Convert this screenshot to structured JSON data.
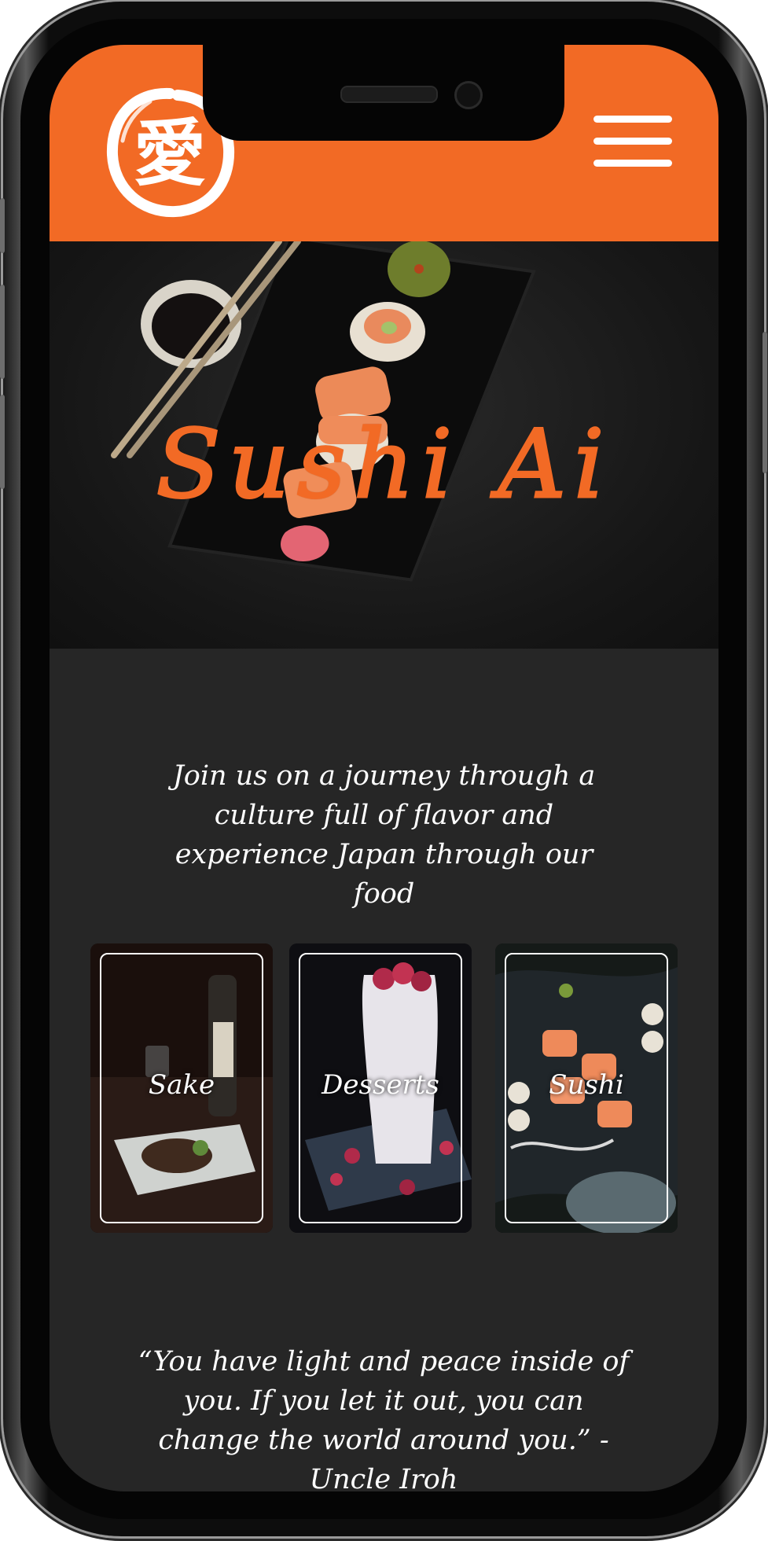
{
  "header": {
    "logo_alt": "Sushi Ai logo",
    "logo_glyph": "愛",
    "menu_icon": "hamburger-menu-icon"
  },
  "hero": {
    "title": "Sushi Ai"
  },
  "intro": {
    "tagline": "Join us on a journey through a culture full of flavor and experience Japan through our food"
  },
  "categories": [
    {
      "label": "Sake"
    },
    {
      "label": "Desserts"
    },
    {
      "label": "Sushi"
    }
  ],
  "quote": {
    "text": "“You have light and peace inside of you. If you let it out, you can change the world around you.” - Uncle Iroh"
  },
  "colors": {
    "brand_orange": "#f26a25",
    "page_background": "#262626",
    "text": "#ffffff"
  }
}
